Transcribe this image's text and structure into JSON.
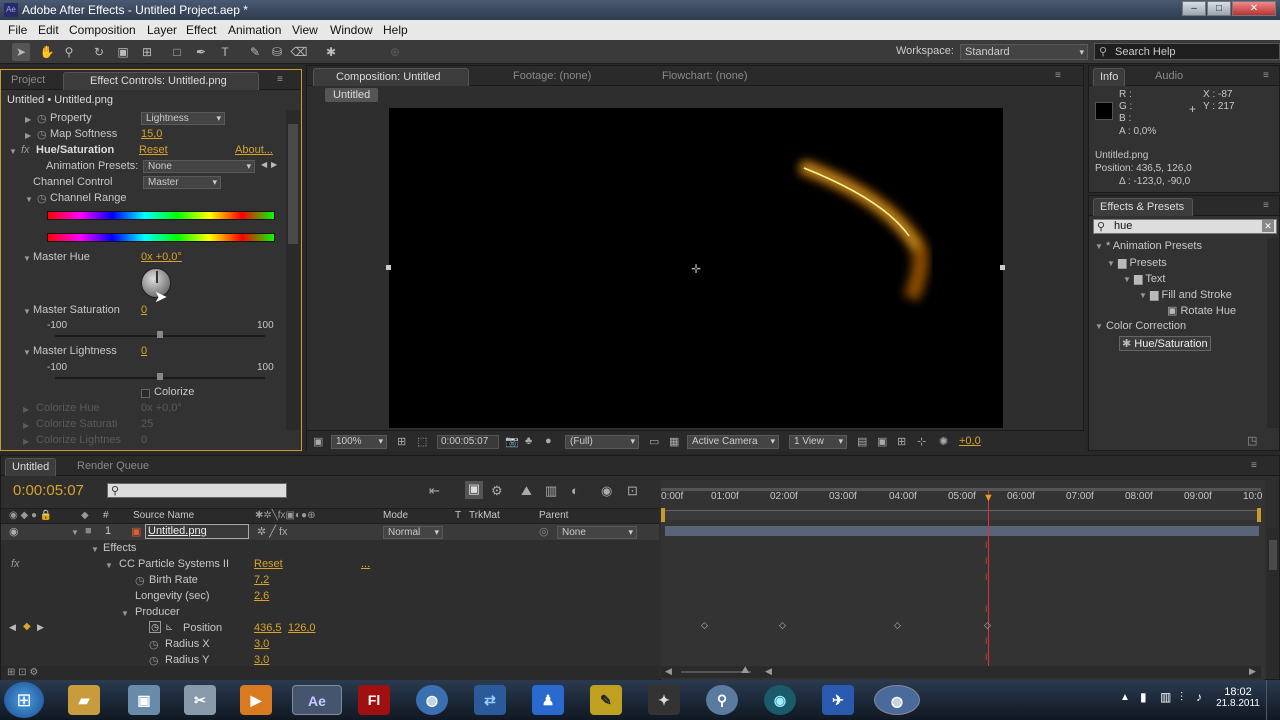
{
  "window": {
    "title": "Adobe After Effects - Untitled Project.aep *",
    "app_icon": "Ae"
  },
  "menu": [
    "File",
    "Edit",
    "Composition",
    "Layer",
    "Effect",
    "Animation",
    "View",
    "Window",
    "Help"
  ],
  "toolbar": {
    "workspace_label": "Workspace:",
    "workspace_value": "Standard",
    "search_placeholder": "Search Help"
  },
  "left_panel": {
    "tabs": [
      "Project",
      "Effect Controls: Untitled.png"
    ],
    "header": "Untitled • Untitled.png",
    "property_label": "Property",
    "property_value": "Lightness",
    "map_softness_label": "Map Softness",
    "map_softness_value": "15,0",
    "effect_name": "Hue/Saturation",
    "reset": "Reset",
    "about": "About...",
    "animation_presets_label": "Animation Presets:",
    "animation_presets_value": "None",
    "channel_control_label": "Channel Control",
    "channel_control_value": "Master",
    "channel_range_label": "Channel Range",
    "master_hue_label": "Master Hue",
    "master_hue_value": "0x +0,0°",
    "master_saturation_label": "Master Saturation",
    "master_saturation_value": "0",
    "sat_min": "-100",
    "sat_max": "100",
    "master_lightness_label": "Master Lightness",
    "master_lightness_value": "0",
    "light_min": "-100",
    "light_max": "100",
    "colorize_label": "Colorize",
    "colorize_hue_label": "Colorize Hue",
    "colorize_hue_value": "0x +0,0°",
    "colorize_sat_label": "Colorize Saturati",
    "colorize_sat_value": "25",
    "colorize_light_label": "Colorize Lightnes",
    "colorize_light_value": "0"
  },
  "comp_panel": {
    "tabs": [
      "Composition: Untitled",
      "Footage: (none)",
      "Flowchart: (none)"
    ],
    "sub_tab": "Untitled",
    "zoom": "100%",
    "timecode": "0:00:05:07",
    "resolution": "(Full)",
    "camera": "Active Camera",
    "views": "1 View",
    "exposure": "+0,0"
  },
  "info_panel": {
    "tabs": [
      "Info",
      "Audio"
    ],
    "r": "R :",
    "g": "G :",
    "b": "B :",
    "a": "A : 0,0%",
    "x": "X : -87",
    "y": "Y : 217",
    "file": "Untitled.png",
    "position": "Position: 436,5, 126,0",
    "delta": "Δ : -123,0, -90,0"
  },
  "effects_presets": {
    "tab": "Effects & Presets",
    "search_value": "hue",
    "tree": [
      {
        "label": "* Animation Presets",
        "level": 0
      },
      {
        "label": "Presets",
        "level": 1
      },
      {
        "label": "Text",
        "level": 2
      },
      {
        "label": "Fill and Stroke",
        "level": 3
      },
      {
        "label": "Rotate Hue",
        "level": 4
      },
      {
        "label": "Color Correction",
        "level": 0
      },
      {
        "label": "Hue/Saturation",
        "level": 1
      }
    ]
  },
  "timeline": {
    "tabs": [
      "Untitled",
      "Render Queue"
    ],
    "timecode": "0:00:05:07",
    "col_headers": {
      "num": "#",
      "source": "Source Name",
      "mode": "Mode",
      "t": "T",
      "trkmat": "TrkMat",
      "parent": "Parent"
    },
    "layer": {
      "num": "1",
      "name": "Untitled.png",
      "mode": "Normal",
      "parent": "None"
    },
    "rows": {
      "effects": "Effects",
      "cc": "CC Particle Systems II",
      "cc_reset": "Reset",
      "cc_dots": "...",
      "birth_rate": "Birth Rate",
      "birth_rate_value": "7,2",
      "longevity": "Longevity (sec)",
      "longevity_value": "2,6",
      "producer": "Producer",
      "position": "Position",
      "position_x": "436,5",
      "position_y": "126,0",
      "radius_x": "Radius X",
      "radius_x_value": "3,0",
      "radius_y": "Radius Y",
      "radius_y_value": "3,0"
    },
    "ruler": [
      "0:00f",
      "01:00f",
      "02:00f",
      "03:00f",
      "04:00f",
      "05:00f",
      "06:00f",
      "07:00f",
      "08:00f",
      "09:00f",
      "10:0"
    ]
  },
  "taskbar": {
    "time": "18:02",
    "date": "21.8.2011"
  }
}
